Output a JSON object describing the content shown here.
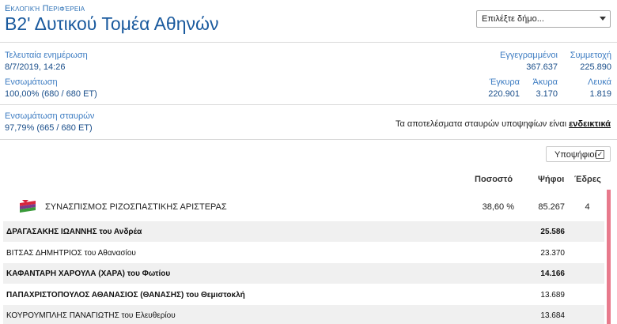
{
  "header": {
    "region_label": "Εκλογική Περιφέρεια",
    "region_title": "Β2' Δυτικού Τομέα Αθηνών",
    "municipality_select": {
      "selected": "Επιλέξτε δήμο..."
    }
  },
  "info": {
    "last_update_label": "Τελευταία ενημέρωση",
    "last_update_value": "8/7/2019, 14:26",
    "incorporation_label": "Ενσωμάτωση",
    "incorporation_value": "100,00% (680 / 680 ΕΤ)",
    "registered_label": "Εγγεγραμμένοι",
    "registered_value": "367.637",
    "turnout_label": "Συμμετοχή",
    "turnout_value": "225.890",
    "valid_label": "Έγκυρα",
    "valid_value": "220.901",
    "invalid_label": "Άκυρα",
    "invalid_value": "3.170",
    "blank_label": "Λευκά",
    "blank_value": "1.819"
  },
  "cross": {
    "label": "Ενσωμάτωση σταυρών",
    "value": "97,79% (665 / 680 ΕΤ)",
    "note_text": "Τα αποτελέσματα σταυρών υποψηφίων είναι ",
    "note_link": "ενδεικτικά"
  },
  "candidates_toggle": {
    "label": "Υποψήφιοι",
    "check": "☑"
  },
  "columns": {
    "percent": "Ποσοστό",
    "votes": "Ψήφοι",
    "seats": "Έδρες"
  },
  "party": {
    "name": "ΣΥΝΑΣΠΙΣΜΟΣ ΡΙΖΟΣΠΑΣΤΙΚΗΣ ΑΡΙΣΤΕΡΑΣ",
    "percent": "38,60 %",
    "votes": "85.267",
    "seats": "4",
    "color": "#e87a8c"
  },
  "candidates": [
    {
      "name": "ΔΡΑΓΑΣΑΚΗΣ ΙΩΑΝΝΗΣ του Ανδρέα",
      "votes": "25.586"
    },
    {
      "name": "ΒΙΤΣΑΣ ΔΗΜΗΤΡΙΟΣ του Αθανασίου",
      "votes": "23.370"
    },
    {
      "name": "ΚΑΦΑΝΤΑΡΗ ΧΑΡΟΥΛΑ (ΧΑΡΑ) του Φωτίου",
      "votes": "14.166"
    },
    {
      "name": "ΠΑΠΑΧΡΙΣΤΟΠΟΥΛΟΣ ΑΘΑΝΑΣΙΟΣ (ΘΑΝΑΣΗΣ) του Θεμιστοκλή",
      "votes": "13.689"
    },
    {
      "name": "ΚΟΥΡΟΥΜΠΛΗΣ ΠΑΝΑΓΙΩΤΗΣ του Ελευθερίου",
      "votes": "13.684"
    }
  ]
}
